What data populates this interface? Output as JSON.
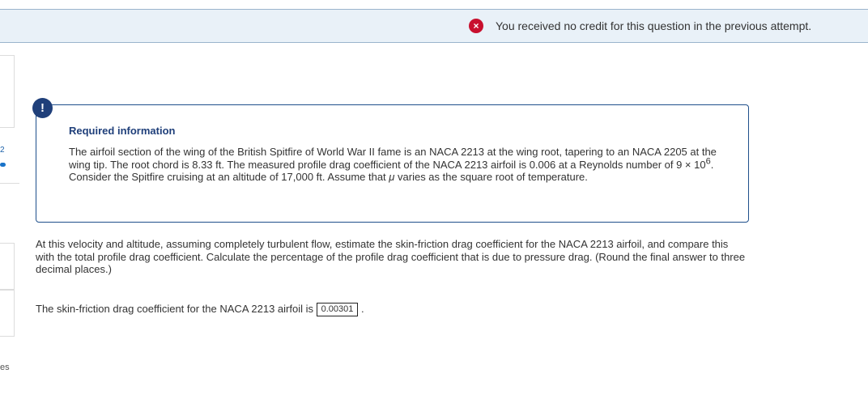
{
  "banner": {
    "status_icon": "x-circle-icon",
    "message": "You received no credit for this question in the previous attempt."
  },
  "sidebar": {
    "mark": "2",
    "tail_text": "es"
  },
  "info": {
    "badge": "!",
    "title": "Required information",
    "text_1": "The airfoil section of the wing of the British Spitfire of World War II fame is an NACA 2213 at the wing root, tapering to an NACA 2205 at the wing tip. The root chord is 8.33 ft. The measured profile drag coefficient of the NACA 2213 airfoil is 0.006 at a Reynolds number of 9 × 10",
    "exponent": "6",
    "text_2": ". Consider the Spitfire cruising at an altitude of 17,000 ft. Assume that ",
    "mu": "μ",
    "text_3": " varies as the square root of temperature."
  },
  "question": {
    "text": "At this velocity and altitude, assuming completely turbulent flow, estimate the skin-friction drag coefficient for the NACA 2213 airfoil, and compare this with the total profile drag coefficient. Calculate the percentage of the profile drag coefficient that is due to pressure drag. (Round the final answer to three decimal places.)"
  },
  "answer": {
    "label": "The skin-friction drag coefficient for the NACA 2213 airfoil is",
    "value": "0.00301",
    "suffix": "."
  }
}
